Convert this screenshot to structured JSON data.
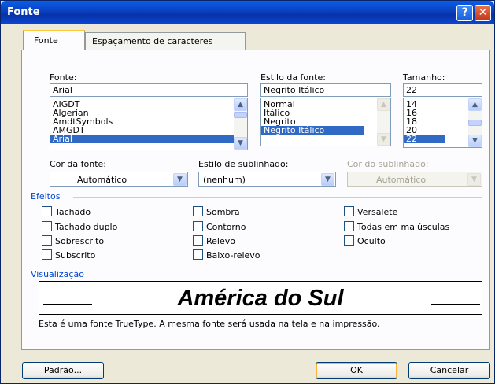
{
  "window": {
    "title": "Fonte",
    "help_glyph": "?",
    "close_glyph": "✕"
  },
  "tabs": [
    {
      "label": "Fonte",
      "active": true
    },
    {
      "label": "Espaçamento de caracteres",
      "active": false
    }
  ],
  "font": {
    "label": "Fonte:",
    "value": "Arial",
    "items": [
      "AIGDT",
      "Algerian",
      "AmdtSymbols",
      "AMGDT",
      "Arial"
    ],
    "selected": "Arial"
  },
  "style": {
    "label": "Estilo da fonte:",
    "value": "Negrito Itálico",
    "items": [
      "Normal",
      "Itálico",
      "Negrito",
      "Negrito Itálico"
    ],
    "selected": "Negrito Itálico"
  },
  "size": {
    "label": "Tamanho:",
    "value": "22",
    "items": [
      "14",
      "16",
      "18",
      "20",
      "22"
    ],
    "selected": "22"
  },
  "font_color": {
    "label": "Cor da fonte:",
    "value": "Automático"
  },
  "underline_style": {
    "label": "Estilo de sublinhado:",
    "value": "(nenhum)"
  },
  "underline_color": {
    "label": "Cor do sublinhado:",
    "value": "Automático",
    "disabled": true
  },
  "effects": {
    "label": "Efeitos",
    "options": [
      {
        "label": "Tachado",
        "checked": false
      },
      {
        "label": "Tachado duplo",
        "checked": false
      },
      {
        "label": "Sobrescrito",
        "checked": false
      },
      {
        "label": "Subscrito",
        "checked": false
      },
      {
        "label": "Sombra",
        "checked": false
      },
      {
        "label": "Contorno",
        "checked": false
      },
      {
        "label": "Relevo",
        "checked": false
      },
      {
        "label": "Baixo-relevo",
        "checked": false
      },
      {
        "label": "Versalete",
        "checked": false
      },
      {
        "label": "Todas em maiúsculas",
        "checked": false
      },
      {
        "label": "Oculto",
        "checked": false
      }
    ]
  },
  "preview": {
    "label": "Visualização",
    "text": "América do Sul",
    "note": "Esta é uma fonte TrueType. A mesma fonte será usada na tela e na impressão."
  },
  "buttons": {
    "default": "Padrão...",
    "ok": "OK",
    "cancel": "Cancelar"
  },
  "colors": {
    "title_bar": "#0a3fbf",
    "dialog_bg": "#ece9d8",
    "selection": "#316ac5",
    "group_label": "#0046d5"
  }
}
